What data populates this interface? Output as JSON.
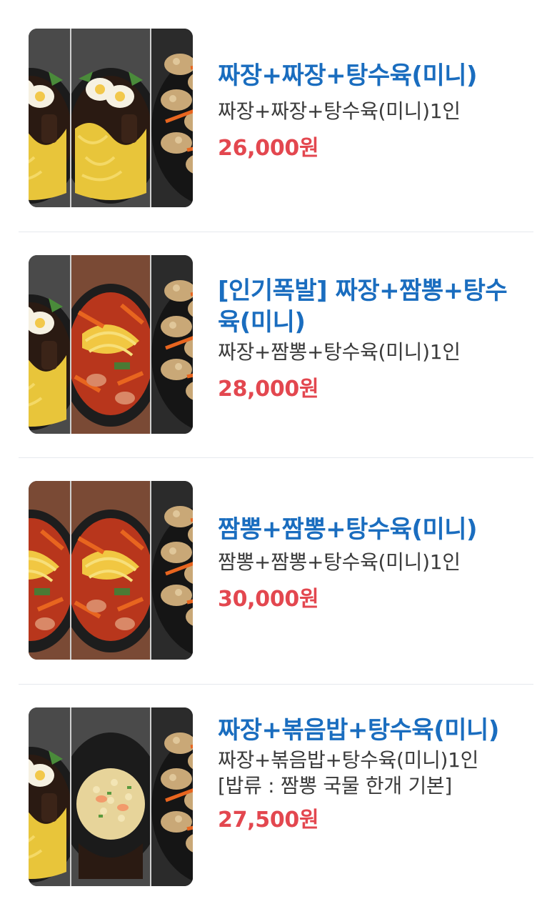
{
  "menu": {
    "items": [
      {
        "title": "짜장+짜장+탕수육(미니)",
        "description": "짜장+짜장+탕수육(미니)1인",
        "note": "",
        "price": "26,000원",
        "strips": [
          "jjajang",
          "jjajang",
          "tangsuyuk"
        ]
      },
      {
        "title": "[인기폭발] 짜장+짬뽕+탕수육(미니)",
        "description": "짜장+짬뽕+탕수육(미니)1인",
        "note": "",
        "price": "28,000원",
        "strips": [
          "jjajang",
          "jjamppong",
          "tangsuyuk"
        ]
      },
      {
        "title": "짬뽕+짬뽕+탕수육(미니)",
        "description": "짬뽕+짬뽕+탕수육(미니)1인",
        "note": "",
        "price": "30,000원",
        "strips": [
          "jjamppong",
          "jjamppong",
          "tangsuyuk"
        ]
      },
      {
        "title": "짜장+볶음밥+탕수육(미니)",
        "description": "짜장+볶음밥+탕수육(미니)1인",
        "note": "[밥류 : 짬뽕 국물 한개 기본]",
        "price": "27,500원",
        "strips": [
          "jjajang",
          "friedrice",
          "tangsuyuk"
        ]
      }
    ]
  },
  "colors": {
    "title": "#1a6dbf",
    "price": "#e3474f",
    "text": "#3a3a3a",
    "divider": "#e6e9ee"
  }
}
